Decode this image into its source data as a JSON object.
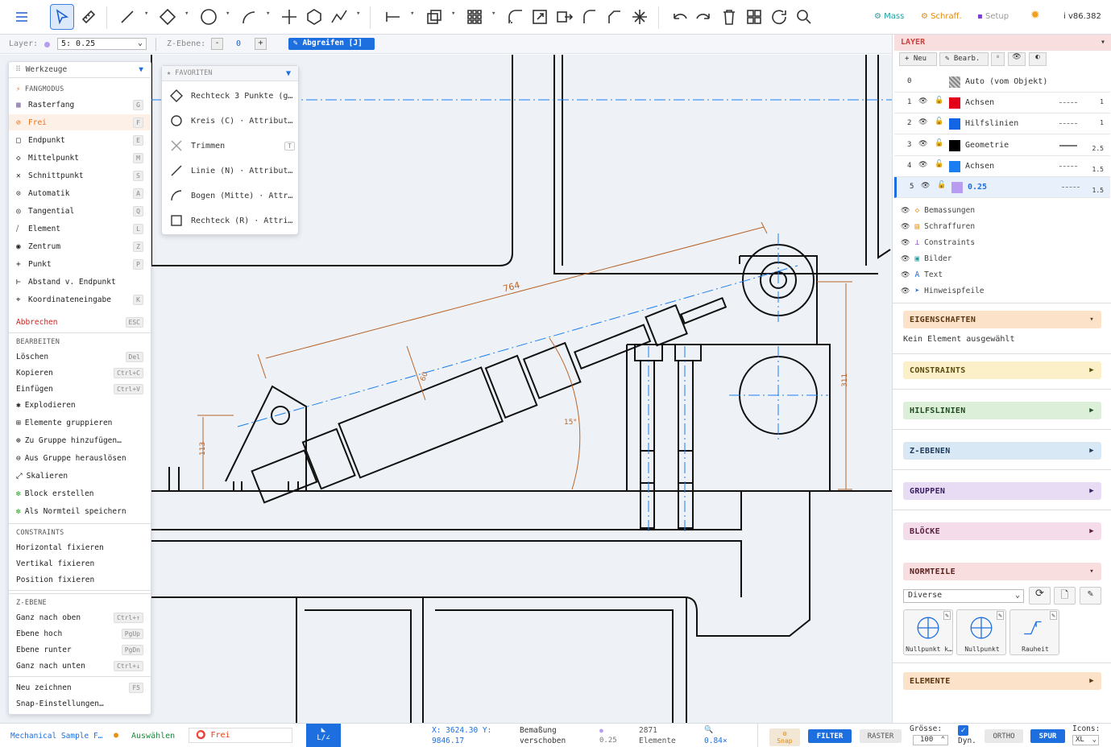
{
  "toolbar": {
    "mass": "Mass",
    "schraff": "Schraff.",
    "setup": "Setup",
    "version": "v86.382"
  },
  "optbar": {
    "layer_label": "Layer:",
    "layer_value": "5: 0.25",
    "zebene_label": "Z-Ebene:",
    "zebene_minus": "-",
    "zebene_value": "0",
    "zebene_plus": "+",
    "abgreifen": "Abgreifen [J]"
  },
  "drawing": {
    "dim_764": "764",
    "dim_60": "60",
    "dim_15": "15°",
    "dim_113": "113",
    "dim_311": "311"
  },
  "leftmenu": {
    "title": "Werkzeuge",
    "fangmodus_header": "FANGMODUS",
    "snap": [
      {
        "label": "Rasterfang",
        "key": "G"
      },
      {
        "label": "Frei",
        "key": "F"
      },
      {
        "label": "Endpunkt",
        "key": "E"
      },
      {
        "label": "Mittelpunkt",
        "key": "M"
      },
      {
        "label": "Schnittpunkt",
        "key": "S"
      },
      {
        "label": "Automatik",
        "key": "A"
      },
      {
        "label": "Tangential",
        "key": "Q"
      },
      {
        "label": "Element",
        "key": "L"
      },
      {
        "label": "Zentrum",
        "key": "Z"
      },
      {
        "label": "Punkt",
        "key": "P"
      },
      {
        "label": "Abstand v. Endpunkt",
        "key": ""
      },
      {
        "label": "Koordinateneingabe",
        "key": "K"
      }
    ],
    "abbrechen": "Abbrechen",
    "abbrechen_key": "ESC",
    "bearbeiten_header": "BEARBEITEN",
    "edit": [
      {
        "label": "Löschen",
        "key": "Del"
      },
      {
        "label": "Kopieren",
        "key": "Ctrl+C"
      },
      {
        "label": "Einfügen",
        "key": "Ctrl+V"
      },
      {
        "label": "Explodieren",
        "key": ""
      },
      {
        "label": "Elemente gruppieren",
        "key": ""
      },
      {
        "label": "Zu Gruppe hinzufügen…",
        "key": ""
      },
      {
        "label": "Aus Gruppe herauslösen",
        "key": ""
      },
      {
        "label": "Skalieren",
        "key": ""
      },
      {
        "label": "Block erstellen",
        "key": ""
      },
      {
        "label": "Als Normteil speichern",
        "key": ""
      }
    ],
    "constraints_header": "CONSTRAINTS",
    "constraints": [
      "Horizontal fixieren",
      "Vertikal fixieren",
      "Position fixieren"
    ],
    "zebene_header": "Z-EBENE",
    "zebene": [
      {
        "label": "Ganz nach oben",
        "key": "Ctrl+↑"
      },
      {
        "label": "Ebene hoch",
        "key": "PgUp"
      },
      {
        "label": "Ebene runter",
        "key": "PgDn"
      },
      {
        "label": "Ganz nach unten",
        "key": "Ctrl+↓"
      }
    ],
    "neu_zeichnen": "Neu zeichnen",
    "neu_key": "F5",
    "snap_settings": "Snap-Einstellungen…"
  },
  "favoriten": {
    "title": "FAVORITEN",
    "items": [
      {
        "label": "Rechteck 3 Punkte (g…",
        "icon": "diamond-icon"
      },
      {
        "label": "Kreis (C) · Attribut…",
        "icon": "circle-icon"
      },
      {
        "label": "Trimmen",
        "icon": "trim-icon",
        "key": "T"
      },
      {
        "label": "Linie (N) · Attribut…",
        "icon": "line-icon"
      },
      {
        "label": "Bogen (Mitte) · Attr…",
        "icon": "arc-icon"
      },
      {
        "label": "Rechteck (R) · Attri…",
        "icon": "rectangle-icon"
      }
    ]
  },
  "layer": {
    "title": "LAYER",
    "neu": "+ Neu",
    "bearb": "Bearb.",
    "rows": [
      {
        "num": "0",
        "name": "Auto (vom Objekt)",
        "color": "#999999",
        "w": ""
      },
      {
        "num": "1",
        "name": "Achsen",
        "color": "#e5001a",
        "w": "1"
      },
      {
        "num": "2",
        "name": "Hilfslinien",
        "color": "#1464e6",
        "w": "1"
      },
      {
        "num": "3",
        "name": "Geometrie",
        "color": "#000000",
        "w": "2.5"
      },
      {
        "num": "4",
        "name": "Achsen",
        "color": "#1a7ef0",
        "w": "1.5"
      },
      {
        "num": "5",
        "name": "0.25",
        "color": "#b89cf0",
        "w": "1.5"
      }
    ],
    "objects": [
      "Bemassungen",
      "Schraffuren",
      "Constraints",
      "Bilder",
      "Text",
      "Hinweispfeile"
    ]
  },
  "eigenschaften": {
    "title": "EIGENSCHAFTEN",
    "text": "Kein Element ausgewählt"
  },
  "panels": [
    "CONSTRAINTS",
    "HILFSLINIEN",
    "Z-EBENEN",
    "GRUPPEN",
    "BLÖCKE"
  ],
  "normteile": {
    "title": "NORMTEILE",
    "select": "Diverse",
    "items": [
      "Nullpunkt k…",
      "Nullpunkt",
      "Rauheit"
    ]
  },
  "elemente": "ELEMENTE",
  "status": {
    "file": "Mechanical Sample F…",
    "mode": "Auswählen",
    "snap": "Frei",
    "coords1": "X: 3624.30 Y:",
    "coords2": "9846.17",
    "msg1": "Bemaßung",
    "msg2": "verschoben",
    "lw": "0.25",
    "count1": "2871",
    "count2": "Elemente",
    "zoom": "0.84×",
    "snap_btn": "Snap",
    "filter": "FILTER",
    "raster": "RASTER",
    "groesse": "Grösse:",
    "groesse_val": "100",
    "dyn": "Dyn.",
    "ortho": "ORTHO",
    "spur": "SPUR",
    "icons": "Icons:",
    "icons_val": "XL"
  }
}
